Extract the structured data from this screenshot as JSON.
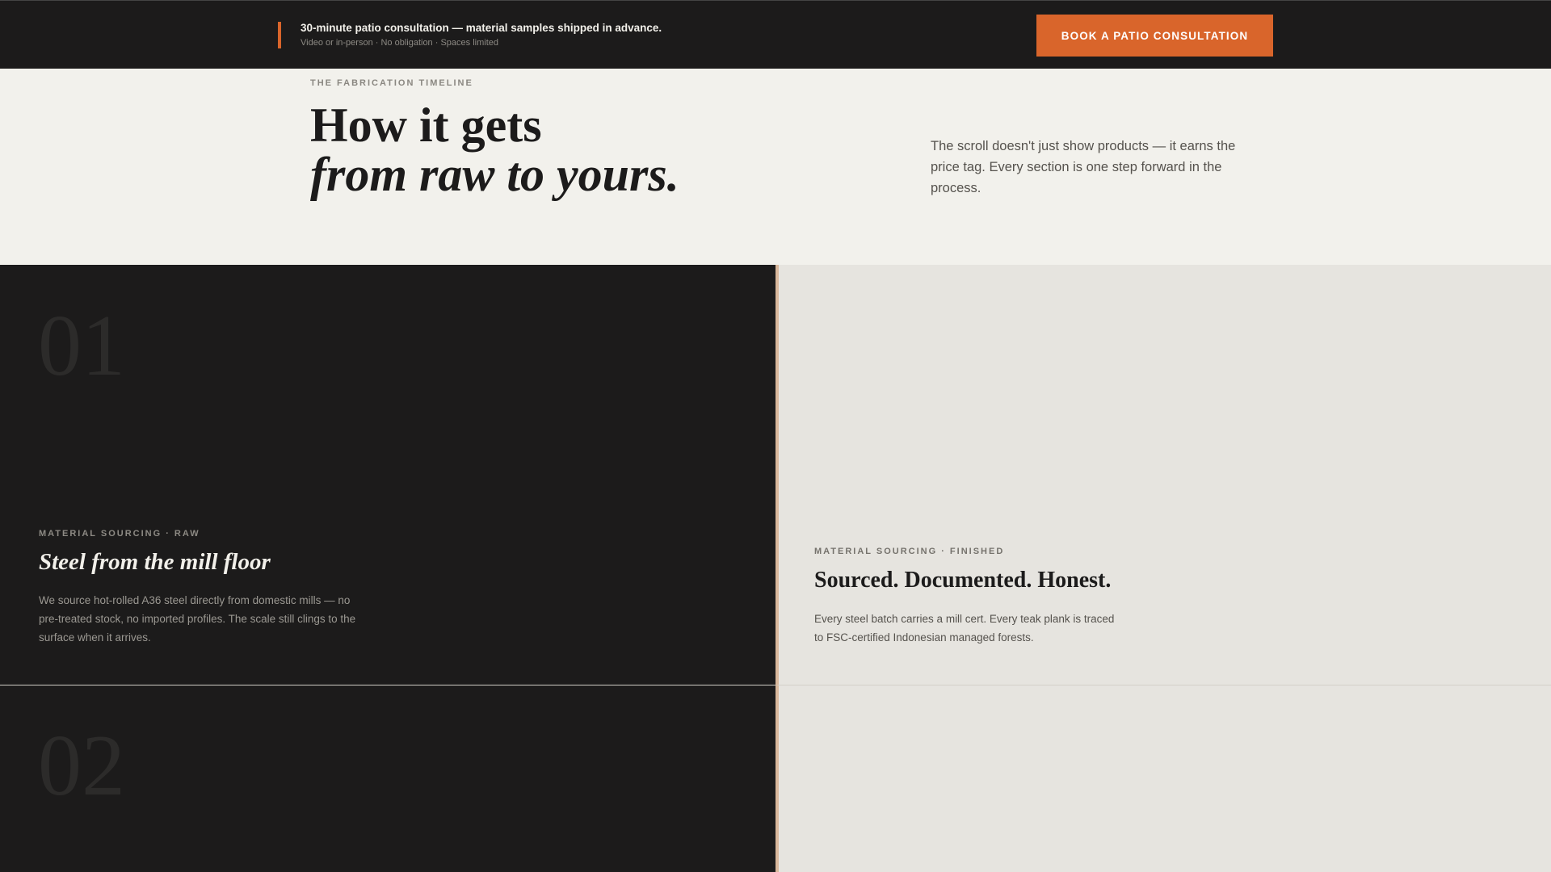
{
  "topbar": {
    "headline": "30-minute patio consultation — material samples shipped in advance.",
    "subline": "Video or in-person · No obligation · Spaces limited",
    "cta_label": "BOOK A PATIO CONSULTATION"
  },
  "intro": {
    "eyebrow": "THE FABRICATION TIMELINE",
    "title_line1": "How it gets",
    "title_line2": "from raw to yours.",
    "copy": "The scroll doesn't just show products — it earns the price tag. Every section is one step forward in the process."
  },
  "steps": [
    {
      "number": "01",
      "raw_tag": "MATERIAL SOURCING · RAW",
      "raw_heading": "Steel from the mill floor",
      "raw_body": "We source hot-rolled A36 steel directly from domestic mills — no pre-treated stock, no imported profiles. The scale still clings to the surface when it arrives.",
      "finished_tag": "MATERIAL SOURCING · FINISHED",
      "finished_heading": "Sourced. Documented. Honest.",
      "finished_body": "Every steel batch carries a mill cert. Every teak plank is traced to FSC-certified Indonesian managed forests."
    },
    {
      "number": "02"
    }
  ],
  "colors": {
    "accent": "#d9652b",
    "dark": "#1c1b1b",
    "cream": "#f2f1ec",
    "stone": "#e6e4df"
  }
}
